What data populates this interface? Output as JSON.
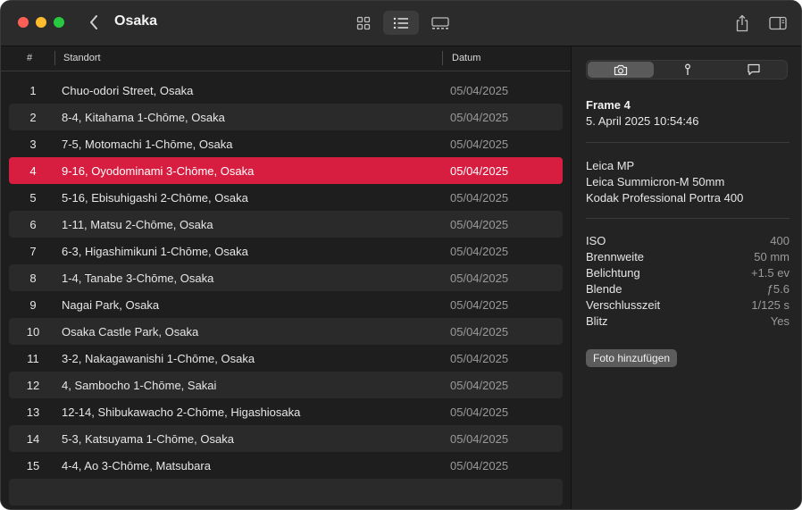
{
  "window": {
    "title": "Osaka"
  },
  "columns": {
    "num": "#",
    "location": "Standort",
    "date": "Datum"
  },
  "rows": [
    {
      "num": "1",
      "location": "Chuo-odori Street, Osaka",
      "date": "05/04/2025"
    },
    {
      "num": "2",
      "location": "8-4, Kitahama 1-Chōme, Osaka",
      "date": "05/04/2025"
    },
    {
      "num": "3",
      "location": "7-5, Motomachi 1-Chōme, Osaka",
      "date": "05/04/2025"
    },
    {
      "num": "4",
      "location": "9-16, Oyodominami 3-Chōme, Osaka",
      "date": "05/04/2025"
    },
    {
      "num": "5",
      "location": "5-16, Ebisuhigashi 2-Chōme, Osaka",
      "date": "05/04/2025"
    },
    {
      "num": "6",
      "location": "1-11, Matsu 2-Chōme, Osaka",
      "date": "05/04/2025"
    },
    {
      "num": "7",
      "location": "6-3, Higashimikuni 1-Chōme, Osaka",
      "date": "05/04/2025"
    },
    {
      "num": "8",
      "location": "1-4, Tanabe 3-Chōme, Osaka",
      "date": "05/04/2025"
    },
    {
      "num": "9",
      "location": "Nagai Park, Osaka",
      "date": "05/04/2025"
    },
    {
      "num": "10",
      "location": "Osaka Castle Park, Osaka",
      "date": "05/04/2025"
    },
    {
      "num": "11",
      "location": "3-2, Nakagawanishi 1-Chōme, Osaka",
      "date": "05/04/2025"
    },
    {
      "num": "12",
      "location": "4, Sambocho 1-Chōme, Sakai",
      "date": "05/04/2025"
    },
    {
      "num": "13",
      "location": "12-14, Shibukawacho 2-Chōme, Higashiosaka",
      "date": "05/04/2025"
    },
    {
      "num": "14",
      "location": "5-3, Katsuyama 1-Chōme, Osaka",
      "date": "05/04/2025"
    },
    {
      "num": "15",
      "location": "4-4, Ao 3-Chōme, Matsubara",
      "date": "05/04/2025"
    }
  ],
  "selected_row": 4,
  "inspector": {
    "tabs": [
      "camera-icon",
      "pin-icon",
      "comment-icon"
    ],
    "frame_title": "Frame 4",
    "frame_datetime": "5. April 2025  10:54:46",
    "camera": "Leica MP",
    "lens": "Leica Summicron-M 50mm",
    "film": "Kodak Professional Portra 400",
    "properties": [
      {
        "key": "ISO",
        "value": "400"
      },
      {
        "key": "Brennweite",
        "value": "50 mm"
      },
      {
        "key": "Belichtung",
        "value": "+1.5 ev"
      },
      {
        "key": "Blende",
        "value": "ƒ5.6"
      },
      {
        "key": "Verschlusszeit",
        "value": "1/125 s"
      },
      {
        "key": "Blitz",
        "value": "Yes"
      }
    ],
    "add_photo_label": "Foto hinzufügen"
  },
  "colors": {
    "accent": "#d81e40",
    "background": "#1e1e1e",
    "stripe": "#2a2a2a"
  }
}
